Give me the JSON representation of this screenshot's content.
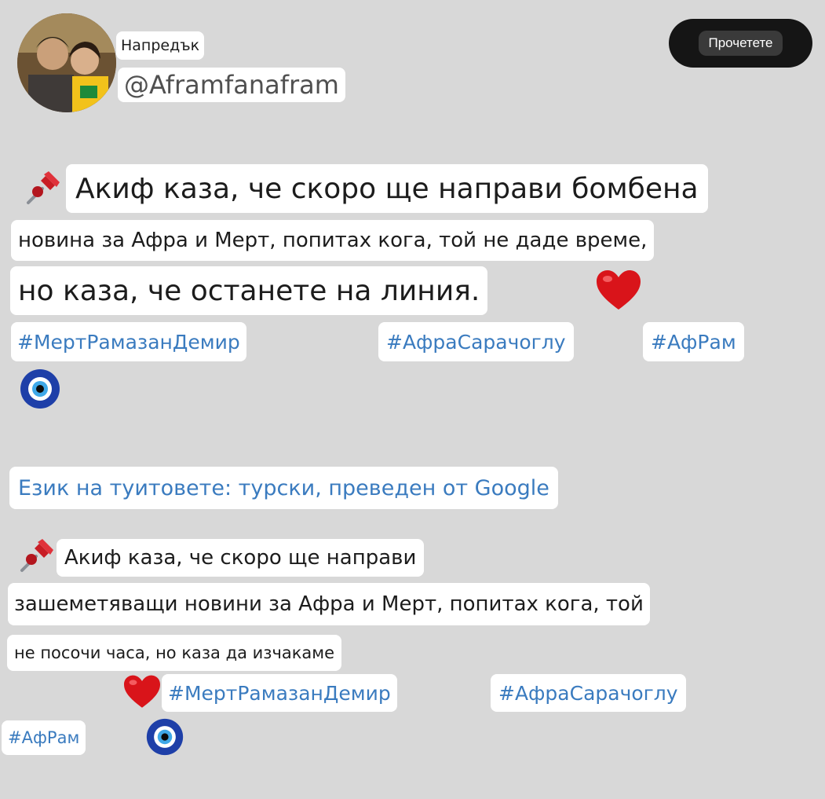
{
  "profile": {
    "status_label": "Напредък",
    "handle": "@Aframfanafram"
  },
  "read_button": {
    "label": "Прочетете"
  },
  "post": {
    "line1": "Акиф каза, че скоро ще направи бомбена",
    "line2": "новина за Афра и Мерт, попитах кога, той не даде време,",
    "line3": "но каза, че останете на линия.",
    "hashtags": [
      "#МертРамазанДемир",
      "#АфраСарачоглу",
      "#АфРам"
    ]
  },
  "translation_notice": "Език на туитовете: турски, преведен от Google",
  "translated": {
    "line1": "Акиф каза, че скоро ще направи",
    "line2": "зашеметяващи новини за Афра и Мерт, попитах кога, той",
    "line3": "не посочи часа, но каза да изчакаме",
    "hashtags": [
      "#МертРамазанДемир",
      "#АфраСарачоглу",
      "#АфРам"
    ]
  },
  "icons": {
    "pin": "pushpin-icon",
    "heart": "heart-icon",
    "evil_eye": "evil-eye-icon"
  },
  "colors": {
    "background": "#d8d8d8",
    "hashtag": "#3a7bbf",
    "heart": "#d9141a",
    "evil_eye": "#1e3fa8"
  }
}
